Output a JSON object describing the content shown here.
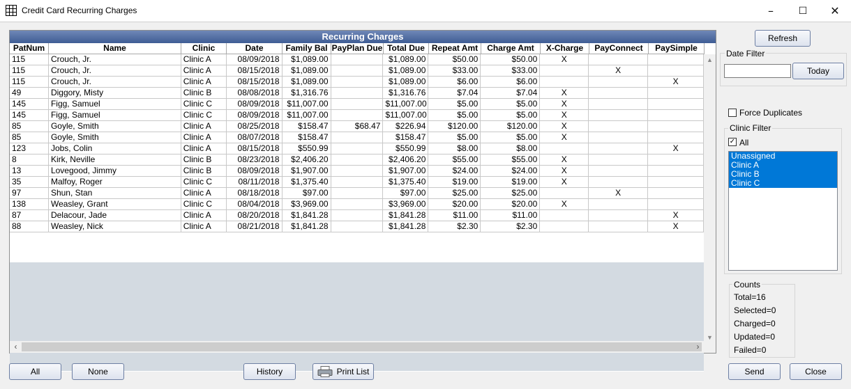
{
  "window": {
    "title": "Credit Card Recurring Charges",
    "icon": "grid-icon",
    "controls": {
      "minimize": "–",
      "maximize": "☐",
      "close": "✕"
    }
  },
  "grid": {
    "title": "Recurring Charges",
    "columns": [
      "PatNum",
      "Name",
      "Clinic",
      "Date",
      "Family Bal",
      "PayPlan Due",
      "Total Due",
      "Repeat Amt",
      "Charge Amt",
      "X-Charge",
      "PayConnect",
      "PaySimple"
    ],
    "rows": [
      [
        "115",
        "Crouch, Jr.",
        "Clinic A",
        "08/09/2018",
        "$1,089.00",
        "",
        "$1,089.00",
        "$50.00",
        "$50.00",
        "X",
        "",
        ""
      ],
      [
        "115",
        "Crouch, Jr.",
        "Clinic A",
        "08/15/2018",
        "$1,089.00",
        "",
        "$1,089.00",
        "$33.00",
        "$33.00",
        "",
        "X",
        ""
      ],
      [
        "115",
        "Crouch, Jr.",
        "Clinic A",
        "08/15/2018",
        "$1,089.00",
        "",
        "$1,089.00",
        "$6.00",
        "$6.00",
        "",
        "",
        "X"
      ],
      [
        "49",
        "Diggory, Misty",
        "Clinic B",
        "08/08/2018",
        "$1,316.76",
        "",
        "$1,316.76",
        "$7.04",
        "$7.04",
        "X",
        "",
        ""
      ],
      [
        "145",
        "Figg, Samuel",
        "Clinic C",
        "08/09/2018",
        "$11,007.00",
        "",
        "$11,007.00",
        "$5.00",
        "$5.00",
        "X",
        "",
        ""
      ],
      [
        "145",
        "Figg, Samuel",
        "Clinic C",
        "08/09/2018",
        "$11,007.00",
        "",
        "$11,007.00",
        "$5.00",
        "$5.00",
        "X",
        "",
        ""
      ],
      [
        "85",
        "Goyle, Smith",
        "Clinic A",
        "08/25/2018",
        "$158.47",
        "$68.47",
        "$226.94",
        "$120.00",
        "$120.00",
        "X",
        "",
        ""
      ],
      [
        "85",
        "Goyle, Smith",
        "Clinic A",
        "08/07/2018",
        "$158.47",
        "",
        "$158.47",
        "$5.00",
        "$5.00",
        "X",
        "",
        ""
      ],
      [
        "123",
        "Jobs, Colin",
        "Clinic A",
        "08/15/2018",
        "$550.99",
        "",
        "$550.99",
        "$8.00",
        "$8.00",
        "",
        "",
        "X"
      ],
      [
        "8",
        "Kirk, Neville",
        "Clinic B",
        "08/23/2018",
        "$2,406.20",
        "",
        "$2,406.20",
        "$55.00",
        "$55.00",
        "X",
        "",
        ""
      ],
      [
        "13",
        "Lovegood, Jimmy",
        "Clinic B",
        "08/09/2018",
        "$1,907.00",
        "",
        "$1,907.00",
        "$24.00",
        "$24.00",
        "X",
        "",
        ""
      ],
      [
        "35",
        "Malfoy, Roger",
        "Clinic C",
        "08/11/2018",
        "$1,375.40",
        "",
        "$1,375.40",
        "$19.00",
        "$19.00",
        "X",
        "",
        ""
      ],
      [
        "97",
        "Shun, Stan",
        "Clinic A",
        "08/18/2018",
        "$97.00",
        "",
        "$97.00",
        "$25.00",
        "$25.00",
        "",
        "X",
        ""
      ],
      [
        "138",
        "Weasley, Grant",
        "Clinic C",
        "08/04/2018",
        "$3,969.00",
        "",
        "$3,969.00",
        "$20.00",
        "$20.00",
        "X",
        "",
        ""
      ],
      [
        "87",
        "Delacour, Jade",
        "Clinic A",
        "08/20/2018",
        "$1,841.28",
        "",
        "$1,841.28",
        "$11.00",
        "$11.00",
        "",
        "",
        "X"
      ],
      [
        "88",
        "Weasley, Nick",
        "Clinic A",
        "08/21/2018",
        "$1,841.28",
        "",
        "$1,841.28",
        "$2.30",
        "$2.30",
        "",
        "",
        "X"
      ]
    ]
  },
  "side": {
    "refresh_label": "Refresh",
    "date_filter_label": "Date Filter",
    "date_value": "",
    "today_label": "Today",
    "force_duplicates_label": "Force Duplicates",
    "force_duplicates_checked": false,
    "clinic_filter_label": "Clinic Filter",
    "all_label": "All",
    "all_checked": true,
    "clinic_items": [
      "Unassigned",
      "Clinic A",
      "Clinic B",
      "Clinic C"
    ],
    "counts_label": "Counts",
    "counts": [
      "Total=16",
      "Selected=0",
      "Charged=0",
      "Updated=0",
      "Failed=0"
    ]
  },
  "bottom": {
    "all_label": "All",
    "none_label": "None",
    "history_label": "History",
    "print_label": "Print List",
    "send_label": "Send",
    "close_label": "Close"
  }
}
